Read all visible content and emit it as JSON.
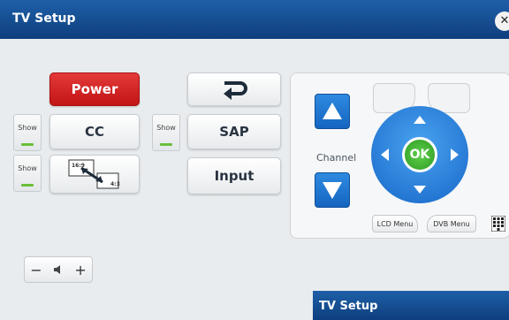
{
  "window": {
    "title": "TV Setup",
    "close_glyph": "✕"
  },
  "left_buttons": {
    "power": "Power",
    "cc": "CC",
    "sap": "SAP",
    "input": "Input",
    "aspect_labels": [
      "16:9",
      "4:3"
    ]
  },
  "show_labels": [
    "Show",
    "Show",
    "Show"
  ],
  "remote": {
    "channel_label": "Channel",
    "ok_label": "OK",
    "lcd_menu": "LCD Menu",
    "dvb_menu": "DVB Menu"
  },
  "volume": {
    "minus": "−",
    "plus": "+"
  },
  "second_window": {
    "title": "TV Setup"
  },
  "colors": {
    "titlebar": "#1e5fa8",
    "power": "#e33a3a",
    "ok": "#3cb82f",
    "channel": "#1e78d6"
  },
  "icons": [
    "close-icon",
    "return-icon",
    "aspect-ratio-icon",
    "arrow-up-icon",
    "arrow-down-icon",
    "arrow-left-icon",
    "arrow-right-icon",
    "speaker-icon",
    "keypad-icon"
  ]
}
